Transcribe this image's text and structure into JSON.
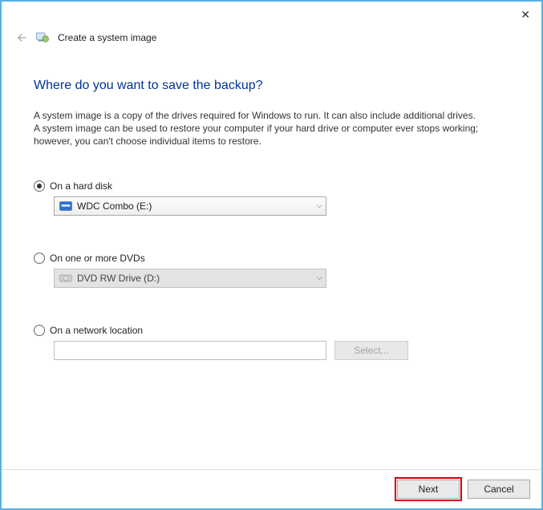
{
  "window": {
    "title": "Create a system image"
  },
  "heading": "Where do you want to save the backup?",
  "description": "A system image is a copy of the drives required for Windows to run. It can also include additional drives. A system image can be used to restore your computer if your hard drive or computer ever stops working; however, you can't choose individual items to restore.",
  "options": {
    "hard_disk": {
      "label": "On a hard disk",
      "selected_value": "WDC Combo (E:)"
    },
    "dvd": {
      "label": "On one or more DVDs",
      "selected_value": "DVD RW Drive (D:)"
    },
    "network": {
      "label": "On a network location",
      "button_label": "Select..."
    }
  },
  "footer": {
    "next": "Next",
    "cancel": "Cancel"
  }
}
